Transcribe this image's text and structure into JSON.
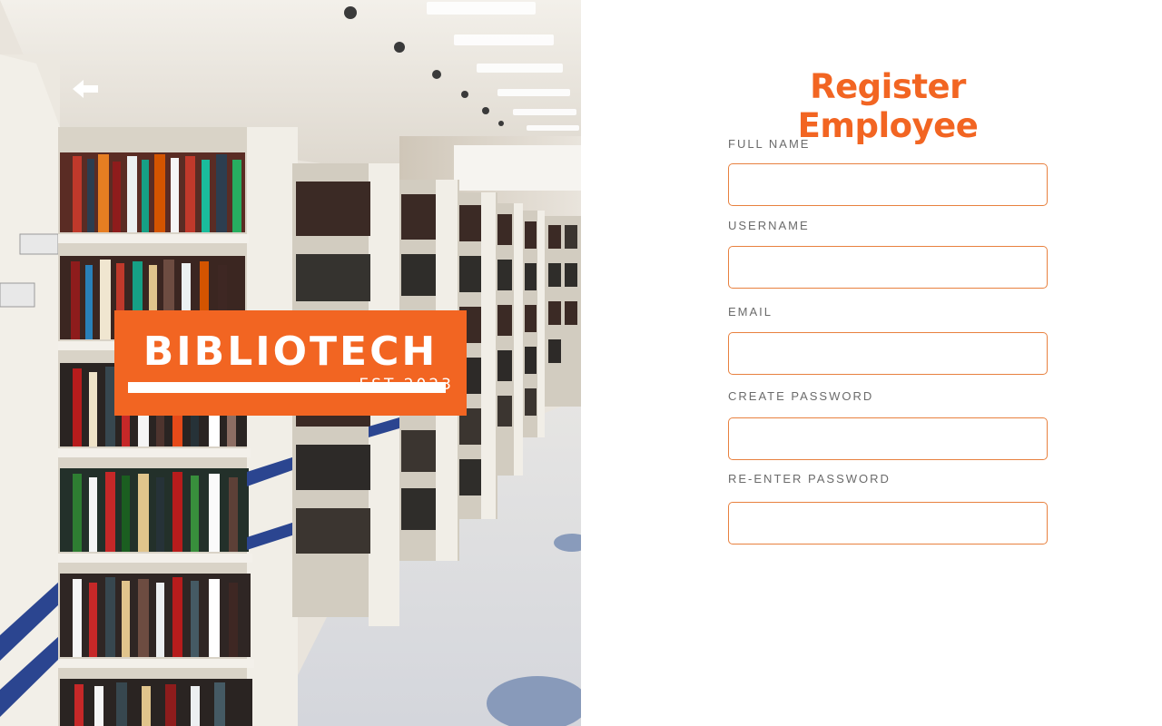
{
  "brand": {
    "name": "BIBLIOTECH",
    "established": "EST 2023",
    "accent_color": "#f26522"
  },
  "navigation": {
    "back_icon": "arrow-left-icon"
  },
  "photo": {
    "subject": "library-bookshelves"
  },
  "form": {
    "title": "Register Employee",
    "fields": [
      {
        "label": "FULL NAME",
        "value": "",
        "placeholder": ""
      },
      {
        "label": "USERNAME",
        "value": "",
        "placeholder": ""
      },
      {
        "label": "EMAIL",
        "value": "",
        "placeholder": ""
      },
      {
        "label": "CREATE PASSWORD",
        "value": "",
        "placeholder": ""
      },
      {
        "label": "RE-ENTER PASSWORD",
        "value": "",
        "placeholder": ""
      }
    ]
  }
}
